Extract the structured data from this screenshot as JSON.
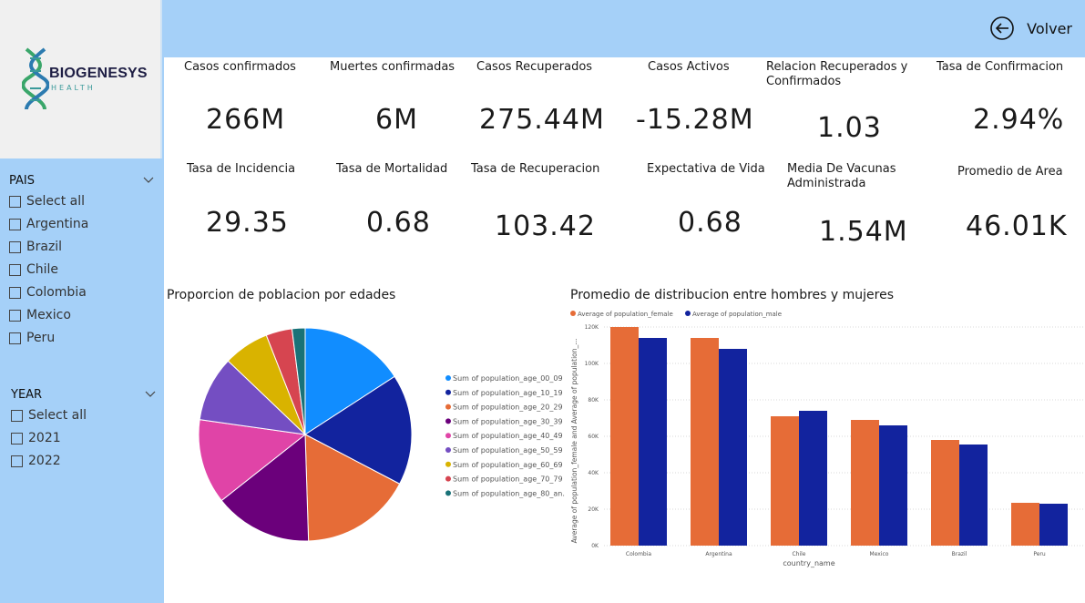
{
  "header": {
    "back_label": "Volver"
  },
  "brand": {
    "name": "BIOGENESYS",
    "sub": "HEALTH"
  },
  "filters": {
    "pais": {
      "title": "PAIS",
      "options": [
        "Select all",
        "Argentina",
        "Brazil",
        "Chile",
        "Colombia",
        "Mexico",
        "Peru"
      ]
    },
    "year": {
      "title": "YEAR",
      "options": [
        "Select all",
        "2021",
        "2022"
      ]
    }
  },
  "kpis": [
    {
      "label": "Casos confirmados",
      "value": "266M"
    },
    {
      "label": "Muertes confirmadas",
      "value": "6M"
    },
    {
      "label": "Casos Recuperados",
      "value": "275.44M"
    },
    {
      "label": "Casos Activos",
      "value": "-15.28M"
    },
    {
      "label": "Relacion Recuperados y Confirmados",
      "value": "1.03"
    },
    {
      "label": "Tasa de Confirmacion",
      "value": "2.94%"
    },
    {
      "label": "Tasa de Incidencia",
      "value": "29.35"
    },
    {
      "label": "Tasa de Mortalidad",
      "value": "0.68"
    },
    {
      "label": "Tasa de Recuperacion",
      "value": "103.42"
    },
    {
      "label": "Expectativa de Vida",
      "value": "0.68"
    },
    {
      "label": "Media De Vacunas Administrada",
      "value": "1.54M"
    },
    {
      "label": "Promedio de Area",
      "value": "46.01K"
    }
  ],
  "colors": {
    "panel": "#a5d0f8",
    "female": "#e66c37",
    "male": "#12239e"
  },
  "chart_data": [
    {
      "type": "pie",
      "title": "Proporcion de poblacion por edades",
      "legend_position": "right",
      "slices": [
        {
          "name": "Sum of population_age_00_09",
          "value": 16,
          "color": "#118dff"
        },
        {
          "name": "Sum of population_age_10_19",
          "value": 17,
          "color": "#12239e"
        },
        {
          "name": "Sum of population_age_20_29",
          "value": 17,
          "color": "#e66c37"
        },
        {
          "name": "Sum of population_age_30_39",
          "value": 15,
          "color": "#6b007b"
        },
        {
          "name": "Sum of population_age_40_49",
          "value": 13,
          "color": "#e044a7"
        },
        {
          "name": "Sum of population_age_50_59",
          "value": 10,
          "color": "#744ec2"
        },
        {
          "name": "Sum of population_age_60_69",
          "value": 7,
          "color": "#d9b300"
        },
        {
          "name": "Sum of population_age_70_79",
          "value": 4,
          "color": "#d64550"
        },
        {
          "name": "Sum of population_age_80_an...",
          "value": 2,
          "color": "#197278"
        }
      ]
    },
    {
      "type": "bar",
      "title": "Promedio de distribucion entre hombres y mujeres",
      "categories": [
        "Colombia",
        "Argentina",
        "Chile",
        "Mexico",
        "Brazil",
        "Peru"
      ],
      "series": [
        {
          "name": "Average of population_female",
          "values": [
            120000,
            114000,
            71000,
            69000,
            58000,
            23500
          ],
          "color": "#e66c37"
        },
        {
          "name": "Average of population_male",
          "values": [
            114000,
            108000,
            74000,
            66000,
            55500,
            23000
          ],
          "color": "#12239e"
        }
      ],
      "xlabel": "country_name",
      "ylabel": "Average of population_female and Average of population_...",
      "ylim": [
        0,
        120000
      ],
      "yticks": [
        "0K",
        "20K",
        "40K",
        "60K",
        "80K",
        "100K",
        "120K"
      ],
      "grid": true,
      "legend_position": "top-left"
    }
  ]
}
